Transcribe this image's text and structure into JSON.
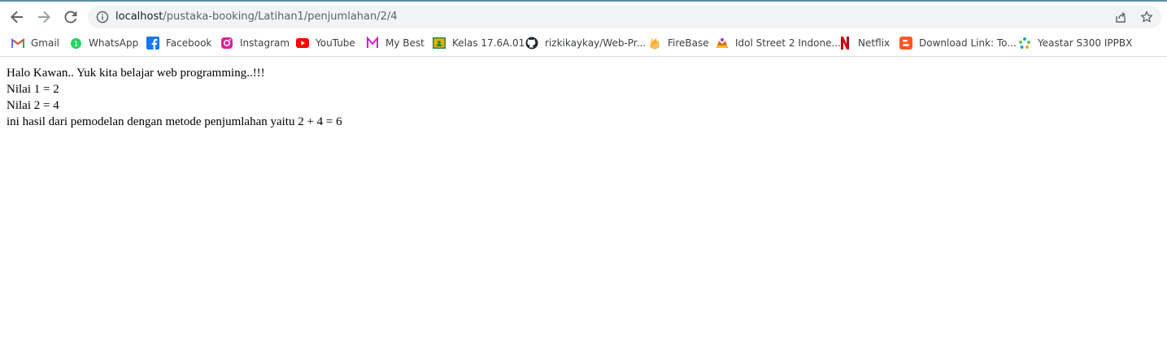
{
  "browser": {
    "url_host": "localhost",
    "url_path": "/pustaka-booking/Latihan1/penjumlahan/2/4",
    "icons": {
      "back": "arrow-left-icon",
      "forward": "arrow-right-icon",
      "reload": "reload-icon",
      "site_info": "info-icon",
      "share": "share-icon",
      "bookmark_star": "star-icon"
    }
  },
  "bookmarks": [
    {
      "label": "Gmail",
      "icon": "gmail-icon",
      "color": "#ea4335"
    },
    {
      "label": "WhatsApp",
      "icon": "whatsapp-icon",
      "color": "#25d366"
    },
    {
      "label": "Facebook",
      "icon": "facebook-icon",
      "color": "#1877f2"
    },
    {
      "label": "Instagram",
      "icon": "instagram-icon",
      "color": "#c13584"
    },
    {
      "label": "YouTube",
      "icon": "youtube-icon",
      "color": "#ff0000"
    },
    {
      "label": "My Best",
      "icon": "mybest-icon",
      "color": "#d81bcf"
    },
    {
      "label": "Kelas 17.6A.01",
      "icon": "classroom-icon",
      "color": "#f9ab00"
    },
    {
      "label": "rizkikaykay/Web-Pr...",
      "icon": "github-icon",
      "color": "#24292e"
    },
    {
      "label": "FireBase",
      "icon": "firebase-icon",
      "color": "#ffa000"
    },
    {
      "label": "Idol Street 2 Indone...",
      "icon": "idolstreet-icon",
      "color": "#e06c2c"
    },
    {
      "label": "Netflix",
      "icon": "netflix-icon",
      "color": "#e50914"
    },
    {
      "label": "Download Link: To...",
      "icon": "blogger-icon",
      "color": "#ff5722"
    },
    {
      "label": "Yeastar S300 IPPBX",
      "icon": "yeastar-icon",
      "color": "#1aa0d8"
    }
  ],
  "page": {
    "line1": "Halo Kawan.. Yuk kita belajar web programming..!!!",
    "line2": "Nilai 1 = 2",
    "line3": "Nilai 2 = 4",
    "line4": "ini hasil dari pemodelan dengan metode penjumlahan yaitu 2 + 4 = 6"
  }
}
